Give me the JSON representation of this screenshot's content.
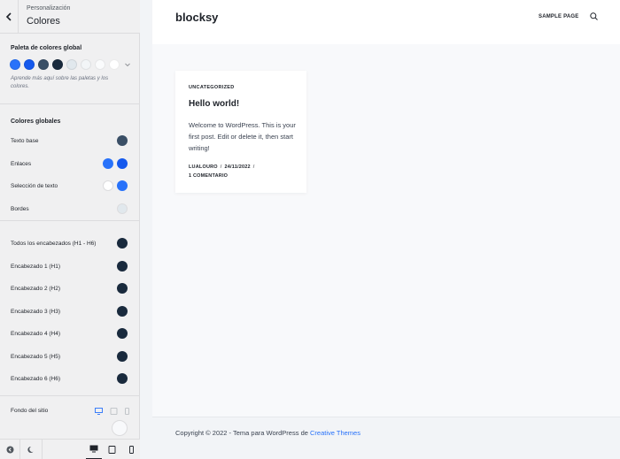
{
  "sidebar": {
    "breadcrumb": "Personalización",
    "title": "Colores",
    "palette_section_title": "Paleta de colores global",
    "palette": [
      "#2872fa",
      "#1559ed",
      "#3a4f66",
      "#192a3d",
      "#e1e8ed",
      "#f2f5f7",
      "#fafbfc",
      "#ffffff"
    ],
    "palette_help": "Aprende más aquí sobre las paletas y los colores.",
    "global_colors_title": "Colores globales",
    "rows": [
      {
        "label": "Texto base",
        "swatches": [
          "#3a4f66"
        ]
      },
      {
        "label": "Enlaces",
        "swatches": [
          "#2872fa",
          "#1559ed"
        ]
      },
      {
        "label": "Selección de texto",
        "swatches": [
          "#ffffff",
          "#2872fa"
        ]
      },
      {
        "label": "Bordes",
        "swatches": [
          "#e1e8ed"
        ]
      }
    ],
    "heading_rows": [
      {
        "label": "Todos los encabezados (H1 - H6)",
        "swatches": [
          "#192a3d"
        ]
      },
      {
        "label": "Encabezado 1 (H1)",
        "swatches": [
          "#192a3d"
        ]
      },
      {
        "label": "Encabezado 2 (H2)",
        "swatches": [
          "#192a3d"
        ]
      },
      {
        "label": "Encabezado 3 (H3)",
        "swatches": [
          "#192a3d"
        ]
      },
      {
        "label": "Encabezado 4 (H4)",
        "swatches": [
          "#192a3d"
        ]
      },
      {
        "label": "Encabezado 5 (H5)",
        "swatches": [
          "#192a3d"
        ]
      },
      {
        "label": "Encabezado 6 (H6)",
        "swatches": [
          "#192a3d"
        ]
      }
    ],
    "site_background_label": "Fondo del sitio",
    "site_background_color": "#f8f9fb"
  },
  "preview": {
    "site_title": "blocksy",
    "nav_item": "SAMPLE PAGE",
    "post": {
      "category": "UNCATEGORIZED",
      "title": "Hello world!",
      "excerpt": "Welcome to WordPress. This is your first post. Edit or delete it, then start writing!",
      "author": "LUALOURO",
      "date": "24/11/2022",
      "comments": "1 COMENTARIO"
    },
    "footer_text": "Copyright © 2022 - Tema para WordPress de ",
    "footer_link": "Creative Themes"
  },
  "colors": {
    "accent": "#2872fa",
    "sidebar_bg": "#f0f0f1",
    "preview_bg": "#f8f9fb"
  }
}
